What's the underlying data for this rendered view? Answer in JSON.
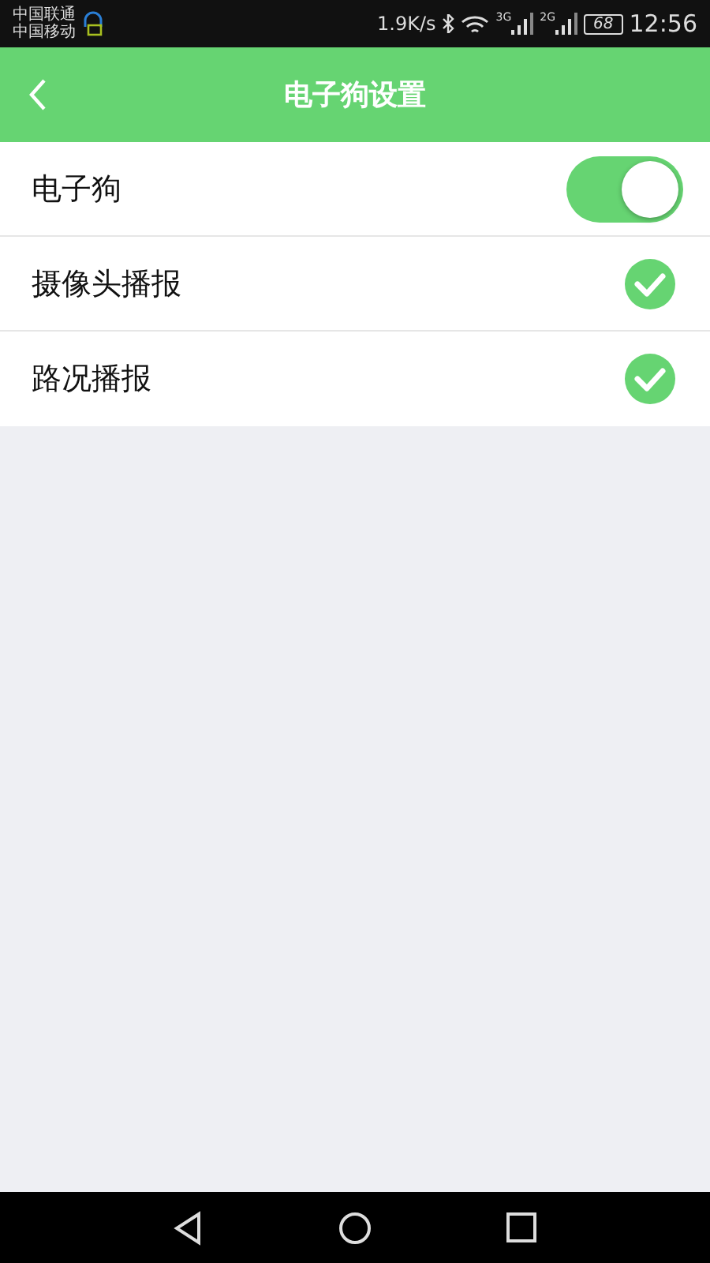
{
  "status_bar": {
    "carriers": [
      "中国联通",
      "中国移动"
    ],
    "net_speed": "1.9K/s",
    "signals": [
      {
        "label": "3G"
      },
      {
        "label": "2G"
      }
    ],
    "battery": "68",
    "time": "12:56"
  },
  "app_bar": {
    "title": "电子狗设置"
  },
  "settings": [
    {
      "kind": "toggle",
      "label": "电子狗",
      "on": true
    },
    {
      "kind": "check",
      "label": "摄像头播报",
      "checked": true
    },
    {
      "kind": "check",
      "label": "路况播报",
      "checked": true
    }
  ]
}
